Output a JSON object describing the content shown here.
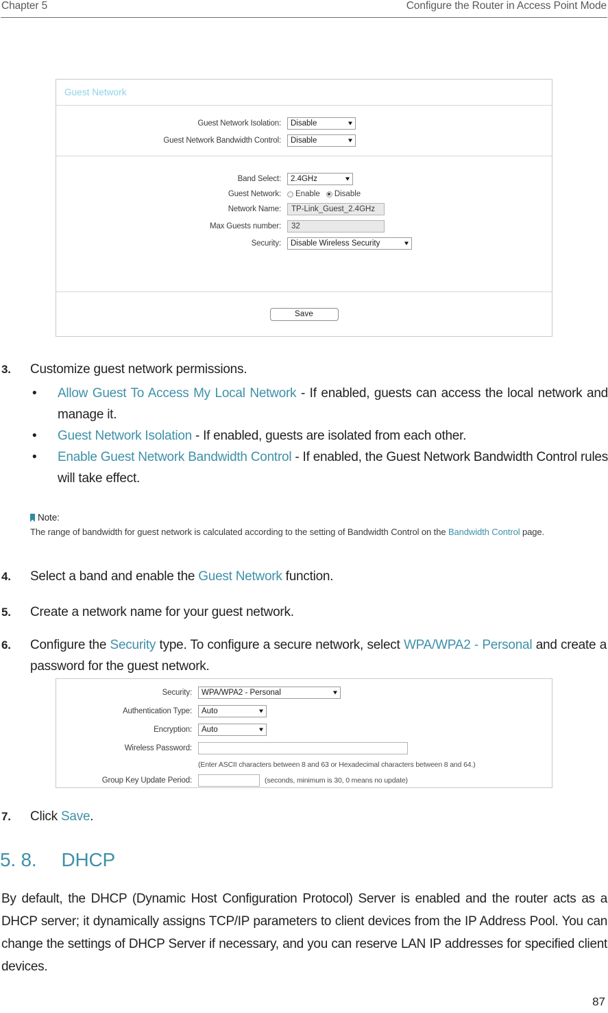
{
  "header": {
    "chapter": "Chapter 5",
    "section": "Configure the Router in Access Point Mode"
  },
  "guest_panel": {
    "title": "Guest Network",
    "isolation_label": "Guest Network Isolation:",
    "isolation_value": "Disable",
    "bandwidth_label": "Guest Network Bandwidth Control:",
    "bandwidth_value": "Disable",
    "band_label": "Band Select:",
    "band_value": "2.4GHz",
    "guest_network_label": "Guest Network:",
    "radio_enable": "Enable",
    "radio_disable": "Disable",
    "network_name_label": "Network Name:",
    "network_name_value": "TP-Link_Guest_2.4GHz",
    "max_guests_label": "Max Guests number:",
    "max_guests_value": "32",
    "security_label": "Security:",
    "security_value": "Disable Wireless Security",
    "save_label": "Save"
  },
  "security_panel": {
    "security_label": "Security:",
    "security_value": "WPA/WPA2 - Personal",
    "auth_label": "Authentication Type:",
    "auth_value": "Auto",
    "encryption_label": "Encryption:",
    "encryption_value": "Auto",
    "password_label": "Wireless Password:",
    "password_value": "",
    "password_hint": "(Enter ASCII characters between 8 and 63 or Hexadecimal characters between 8 and 64.)",
    "group_key_label": "Group Key Update Period:",
    "group_key_value": "",
    "group_key_hint": "(seconds, minimum is 30, 0 means no update)"
  },
  "steps": {
    "step3_num": "3.",
    "step3_text": "Customize guest network permissions.",
    "bullet1_em": "Allow Guest To Access My Local Network",
    "bullet1_rest": " - If enabled, guests can access the local network and manage it.",
    "bullet2_em": "Guest Network Isolation",
    "bullet2_rest": " - If enabled, guests are isolated from each other.",
    "bullet3_em": "Enable Guest Network Bandwidth Control",
    "bullet3_rest": " - If enabled, the Guest Network Bandwidth Control rules will take effect.",
    "step4_num": "4.",
    "step4_pre": "Select a band and enable the ",
    "step4_em": "Guest Network",
    "step4_post": " function.",
    "step5_num": "5.",
    "step5_text": "Create a network name for your guest network.",
    "step6_num": "6.",
    "step6_pre": "Configure the ",
    "step6_em1": "Security",
    "step6_mid": " type. To configure a secure network, select ",
    "step6_em2": "WPA/WPA2 - Personal",
    "step6_post": " and create a password for the guest network.",
    "step7_num": "7.",
    "step7_pre": "Click ",
    "step7_em": "Save",
    "step7_post": "."
  },
  "note": {
    "title": "Note:",
    "body_pre": "The range of bandwidth for guest network is calculated according to the setting of Bandwidth Control on the ",
    "body_em": "Bandwidth Control",
    "body_post": " page."
  },
  "dhcp": {
    "heading_num": "5. 8.",
    "heading_text": "DHCP",
    "paragraph": "By default, the DHCP (Dynamic Host Configuration Protocol) Server is enabled and the router acts as a DHCP server; it dynamically assigns TCP/IP parameters to client devices from the IP Address Pool. You can change the settings of DHCP Server if necessary, and you can reserve LAN IP addresses for specified client devices."
  },
  "footer": {
    "page_number": "87"
  },
  "colors": {
    "accent_teal": "#3f90a8",
    "panel_title_blue": "#8ed1e8",
    "header_gray": "#58595b"
  }
}
